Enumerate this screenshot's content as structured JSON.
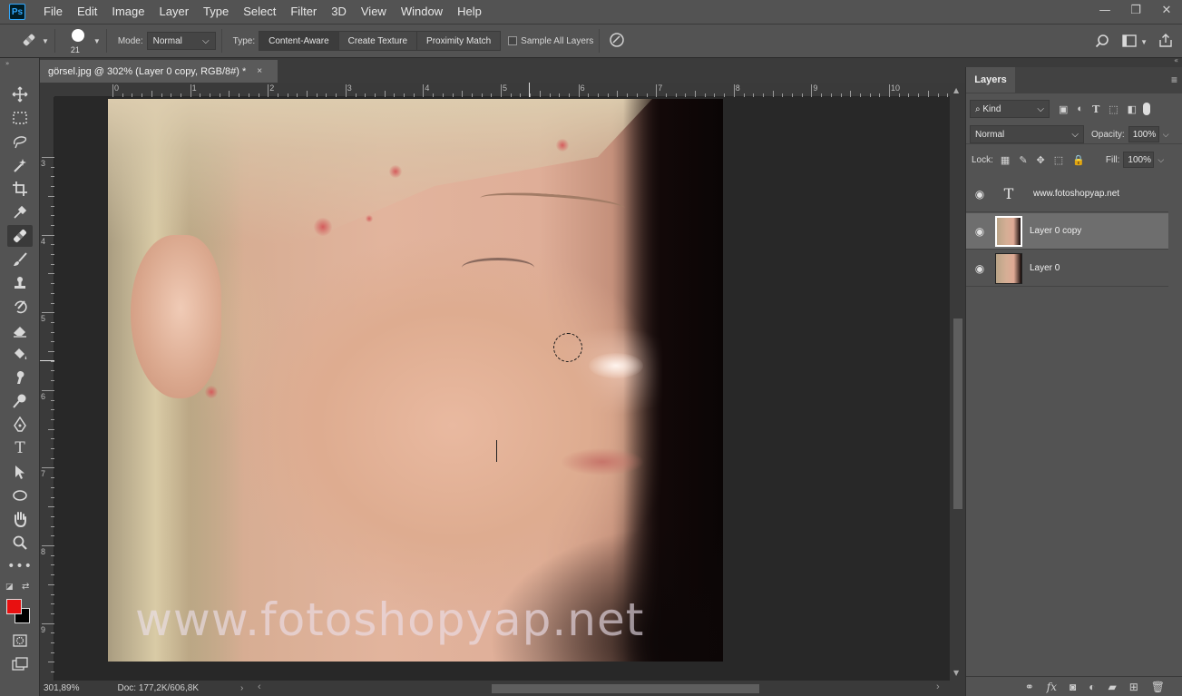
{
  "app": {
    "logo": "Ps"
  },
  "menu": [
    "File",
    "Edit",
    "Image",
    "Layer",
    "Type",
    "Select",
    "Filter",
    "3D",
    "View",
    "Window",
    "Help"
  ],
  "window_controls": {
    "minimize": "—",
    "restore": "❐",
    "close": "✕"
  },
  "options": {
    "brush_size": "21",
    "mode_label": "Mode:",
    "mode_value": "Normal",
    "type_label": "Type:",
    "types": [
      "Content-Aware",
      "Create Texture",
      "Proximity Match"
    ],
    "sample_all_layers": "Sample All Layers"
  },
  "document": {
    "tab_title": "görsel.jpg @ 302% (Layer 0 copy, RGB/8#) *",
    "close": "×",
    "ruler_h": [
      "0",
      "1",
      "2",
      "3",
      "4",
      "5",
      "6",
      "7",
      "8",
      "9",
      "10"
    ],
    "ruler_v": [
      "3",
      "4",
      "5",
      "6",
      "7",
      "8",
      "9"
    ],
    "watermark": "www.fotoshopyap.net"
  },
  "status": {
    "zoom": "301,89%",
    "doc": "Doc: 177,2K/606,8K",
    "arrow": "›"
  },
  "layers_panel": {
    "tab": "Layers",
    "filter": "Kind",
    "blend_mode": "Normal",
    "opacity_label": "Opacity:",
    "opacity": "100%",
    "lock_label": "Lock:",
    "fill_label": "Fill:",
    "fill": "100%",
    "layers": [
      {
        "name": "www.fotoshopyap.net",
        "kind": "type"
      },
      {
        "name": "Layer 0 copy",
        "kind": "pixel",
        "selected": true
      },
      {
        "name": "Layer 0",
        "kind": "pixel"
      }
    ]
  },
  "colors": {
    "foreground": "#e81010",
    "background": "#000000",
    "accent": "#31a8ff"
  }
}
